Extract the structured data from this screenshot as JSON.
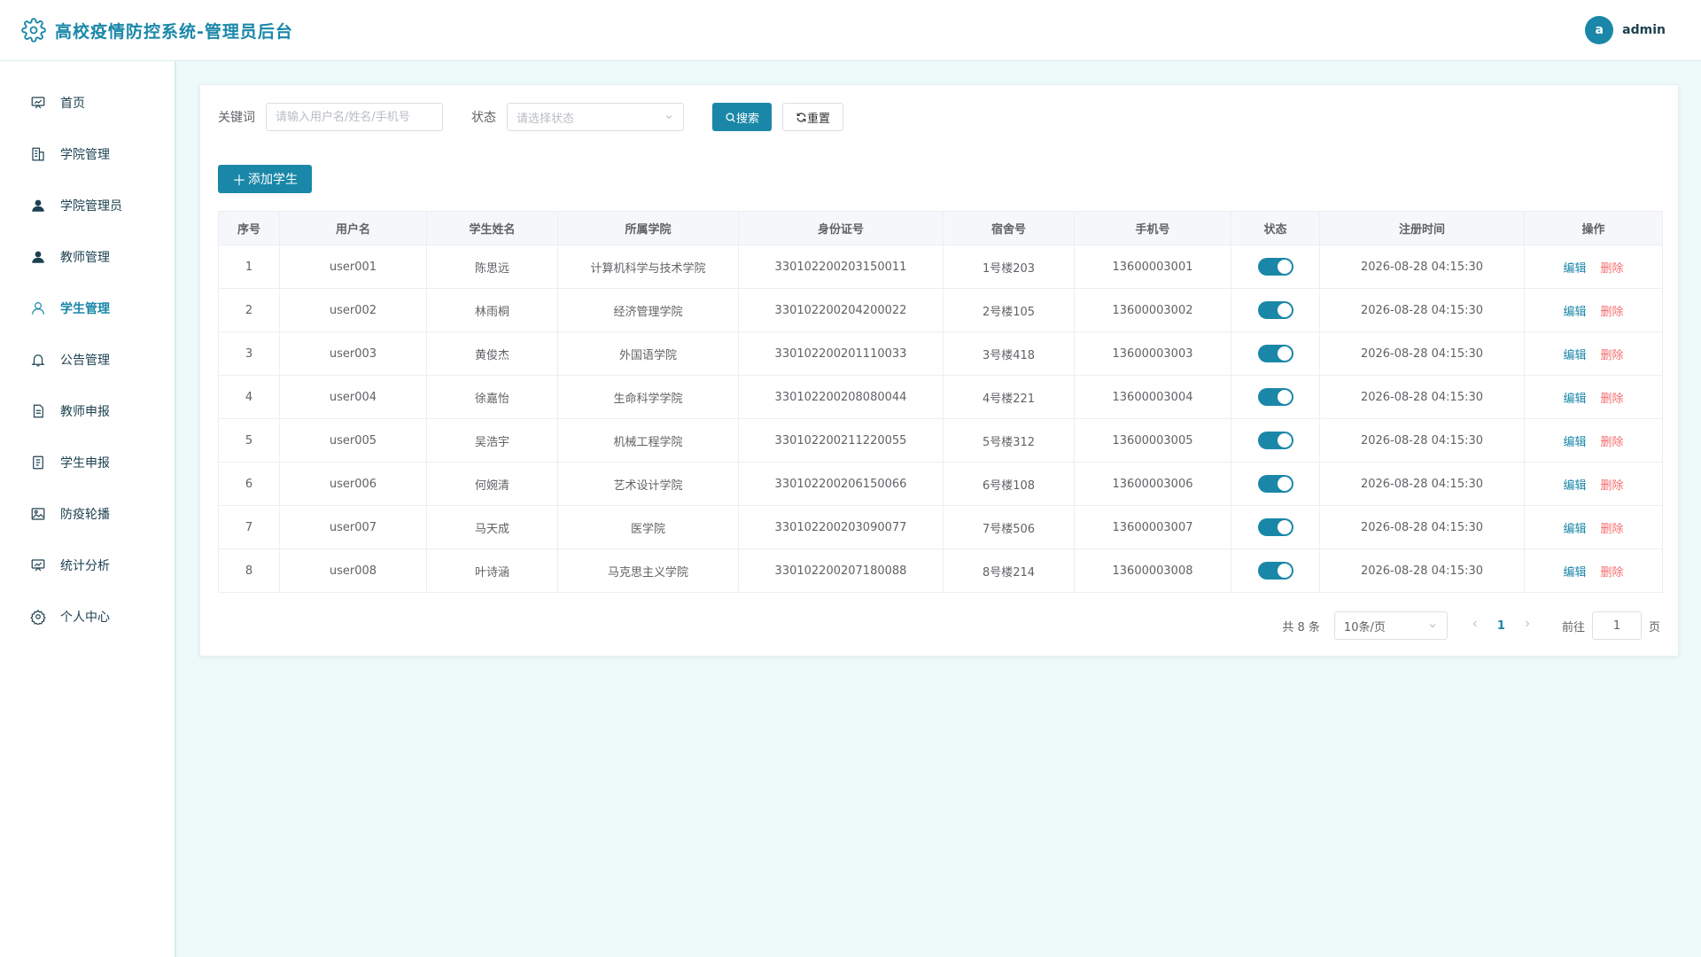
{
  "header": {
    "title": "高校疫情防控系统-管理员后台",
    "avatar_letter": "a",
    "username": "admin"
  },
  "sidebar": {
    "items": [
      {
        "label": "首页",
        "icon": "chart-board-icon",
        "active": false
      },
      {
        "label": "学院管理",
        "icon": "building-icon",
        "active": false
      },
      {
        "label": "学院管理员",
        "icon": "user-solid-icon",
        "active": false
      },
      {
        "label": "教师管理",
        "icon": "user-solid-icon",
        "active": false
      },
      {
        "label": "学生管理",
        "icon": "user-outline-icon",
        "active": true
      },
      {
        "label": "公告管理",
        "icon": "bell-icon",
        "active": false
      },
      {
        "label": "教师申报",
        "icon": "document-icon",
        "active": false
      },
      {
        "label": "学生申报",
        "icon": "document-list-icon",
        "active": false
      },
      {
        "label": "防疫轮播",
        "icon": "picture-icon",
        "active": false
      },
      {
        "label": "统计分析",
        "icon": "chart-board-icon",
        "active": false
      },
      {
        "label": "个人中心",
        "icon": "gear-icon",
        "active": false
      }
    ]
  },
  "filters": {
    "keyword_label": "关键词",
    "keyword_placeholder": "请输入用户名/姓名/手机号",
    "status_label": "状态",
    "status_placeholder": "请选择状态",
    "search_label": "搜索",
    "reset_label": "重置"
  },
  "add_button_label": "添加学生",
  "table": {
    "columns": [
      "序号",
      "用户名",
      "学生姓名",
      "所属学院",
      "身份证号",
      "宿舍号",
      "手机号",
      "状态",
      "注册时间",
      "操作"
    ],
    "edit_label": "编辑",
    "delete_label": "删除",
    "rows": [
      {
        "no": "1",
        "username": "user001",
        "name": "陈思远",
        "college": "计算机科学与技术学院",
        "id_card": "330102200203150011",
        "dorm": "1号楼203",
        "phone": "13600003001",
        "enabled": true,
        "registered": "2026-08-28 04:15:30"
      },
      {
        "no": "2",
        "username": "user002",
        "name": "林雨桐",
        "college": "经济管理学院",
        "id_card": "330102200204200022",
        "dorm": "2号楼105",
        "phone": "13600003002",
        "enabled": true,
        "registered": "2026-08-28 04:15:30"
      },
      {
        "no": "3",
        "username": "user003",
        "name": "黄俊杰",
        "college": "外国语学院",
        "id_card": "330102200201110033",
        "dorm": "3号楼418",
        "phone": "13600003003",
        "enabled": true,
        "registered": "2026-08-28 04:15:30"
      },
      {
        "no": "4",
        "username": "user004",
        "name": "徐嘉怡",
        "college": "生命科学学院",
        "id_card": "330102200208080044",
        "dorm": "4号楼221",
        "phone": "13600003004",
        "enabled": true,
        "registered": "2026-08-28 04:15:30"
      },
      {
        "no": "5",
        "username": "user005",
        "name": "吴浩宇",
        "college": "机械工程学院",
        "id_card": "330102200211220055",
        "dorm": "5号楼312",
        "phone": "13600003005",
        "enabled": true,
        "registered": "2026-08-28 04:15:30"
      },
      {
        "no": "6",
        "username": "user006",
        "name": "何婉清",
        "college": "艺术设计学院",
        "id_card": "330102200206150066",
        "dorm": "6号楼108",
        "phone": "13600003006",
        "enabled": true,
        "registered": "2026-08-28 04:15:30"
      },
      {
        "no": "7",
        "username": "user007",
        "name": "马天成",
        "college": "医学院",
        "id_card": "330102200203090077",
        "dorm": "7号楼506",
        "phone": "13600003007",
        "enabled": true,
        "registered": "2026-08-28 04:15:30"
      },
      {
        "no": "8",
        "username": "user008",
        "name": "叶诗涵",
        "college": "马克思主义学院",
        "id_card": "330102200207180088",
        "dorm": "8号楼214",
        "phone": "13600003008",
        "enabled": true,
        "registered": "2026-08-28 04:15:30"
      }
    ]
  },
  "pagination": {
    "total_text": "共 8 条",
    "page_size": "10条/页",
    "current_page": "1",
    "goto_label": "前往",
    "goto_value": "1",
    "page_unit": "页"
  },
  "colors": {
    "primary": "#1a87a8",
    "danger": "#f56c6c",
    "background": "#eefaf9"
  }
}
